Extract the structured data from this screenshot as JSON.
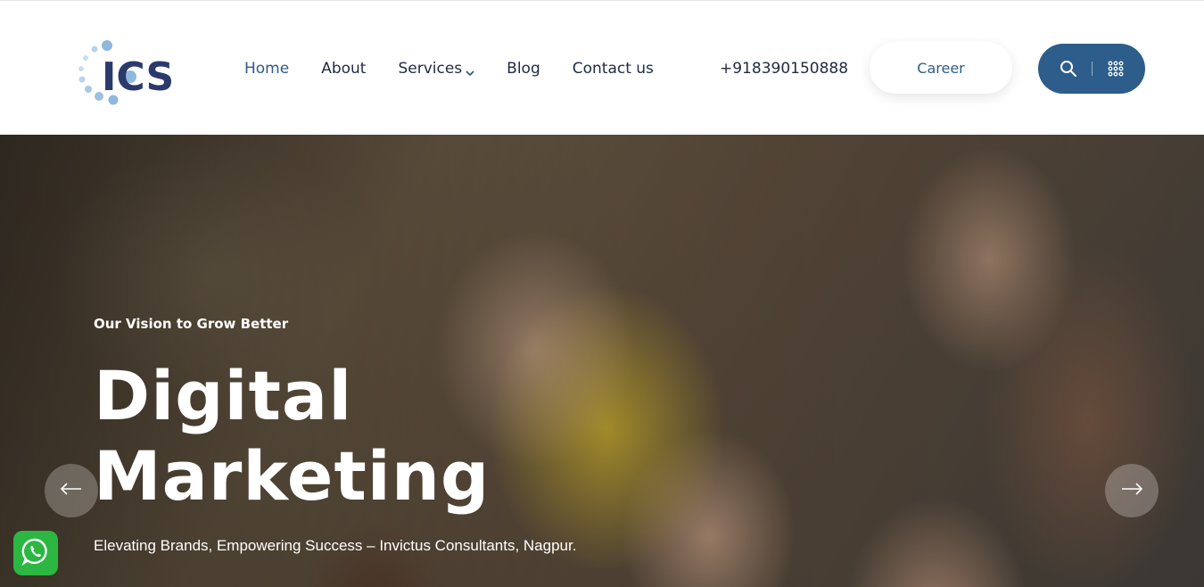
{
  "header": {
    "logo_text": "ICS",
    "nav": [
      {
        "label": "Home",
        "active": true
      },
      {
        "label": "About"
      },
      {
        "label": "Services",
        "has_dropdown": true
      },
      {
        "label": "Blog"
      },
      {
        "label": "Contact us"
      }
    ],
    "phone": "+918390150888",
    "career_label": "Career",
    "search_icon": "search-icon",
    "menu_icon": "grid-menu-icon"
  },
  "hero": {
    "eyebrow": "Our Vision to Grow Better",
    "title_line1": "Digital",
    "title_line2": "Marketing",
    "subtitle": "Elevating Brands, Empowering Success – Invictus Consultants, Nagpur.",
    "prev_icon": "arrow-left-icon",
    "next_icon": "arrow-right-icon"
  },
  "widgets": {
    "whatsapp_icon": "whatsapp-icon"
  },
  "colors": {
    "brand": "#2d5d8a",
    "text_dark": "#1f2a44",
    "logo_dots": "#8fb8dc",
    "whatsapp": "#2bb741"
  }
}
